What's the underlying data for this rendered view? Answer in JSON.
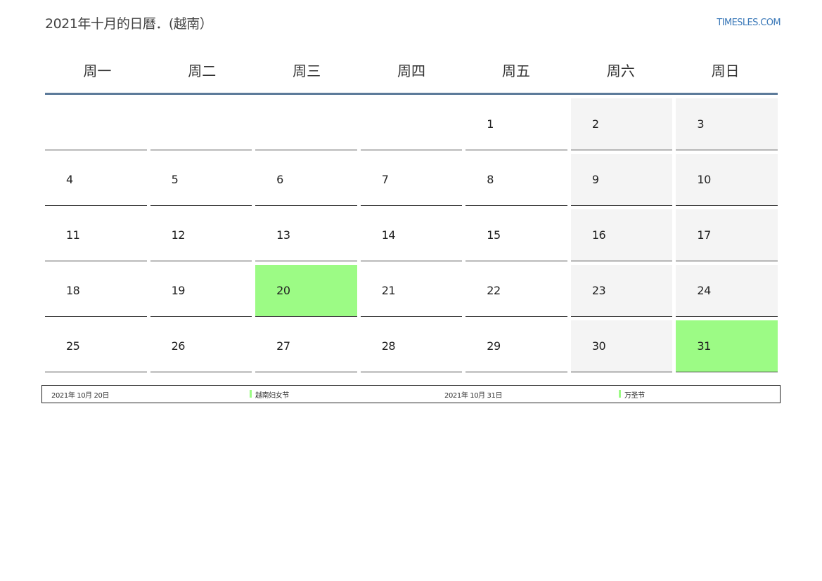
{
  "header": {
    "title": "2021年十月的日曆．(越南）",
    "brand": "TIMESLES.COM"
  },
  "weekdays": [
    "周一",
    "周二",
    "周三",
    "周四",
    "周五",
    "周六",
    "周日"
  ],
  "weeks": [
    [
      "",
      "",
      "",
      "",
      "1",
      "2",
      "3"
    ],
    [
      "4",
      "5",
      "6",
      "7",
      "8",
      "9",
      "10"
    ],
    [
      "11",
      "12",
      "13",
      "14",
      "15",
      "16",
      "17"
    ],
    [
      "18",
      "19",
      "20",
      "21",
      "22",
      "23",
      "24"
    ],
    [
      "25",
      "26",
      "27",
      "28",
      "29",
      "30",
      "31"
    ]
  ],
  "holiday_days": [
    "20",
    "31"
  ],
  "colors": {
    "holiday": "#9cfb85",
    "weekend": "#f4f4f4",
    "header_rule": "#5c7a9a",
    "brand": "#3a78b8"
  },
  "holidays": [
    {
      "date": "2021年 10月 20日",
      "name": "越南妇女节"
    },
    {
      "date": "2021年 10月 31日",
      "name": "万圣节"
    }
  ]
}
